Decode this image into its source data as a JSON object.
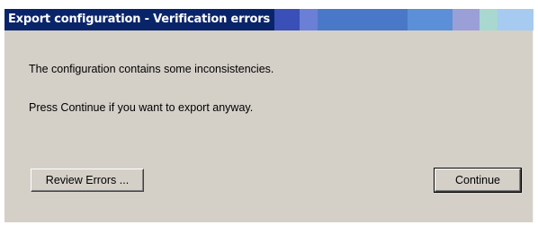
{
  "dialog": {
    "title": "Export configuration - Verification errors",
    "titlebar_colors": [
      "#0a246a",
      "#3a4fb8",
      "#6b7fd6",
      "#4a78c8",
      "#5b8fd8",
      "#9b9fd8",
      "#a8d8d0",
      "#a6caf0"
    ]
  },
  "message": {
    "line1": "The configuration contains some inconsistencies.",
    "line2": "Press Continue if you want to export anyway."
  },
  "buttons": {
    "review_label": "Review Errors ...",
    "continue_label": "Continue"
  }
}
